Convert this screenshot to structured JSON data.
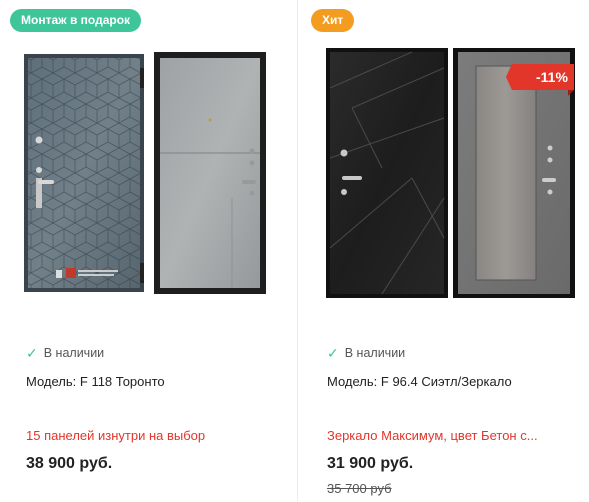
{
  "cards": [
    {
      "badge": "Монтаж в подарок",
      "stock": "В наличии",
      "model": "Модель: F 118 Торонто",
      "promo": "15 панелей изнутри на выбор",
      "price": "38 900 руб."
    },
    {
      "badge": "Хит",
      "discount": "-11%",
      "stock": "В наличии",
      "model": "Модель: F 96.4 Сиэтл/Зеркало",
      "promo": "Зеркало Максимум, цвет Бетон с...",
      "price": "31 900 руб.",
      "old_price": "35 700 руб"
    }
  ],
  "colors": {
    "badge_green": "#3ec59a",
    "badge_orange": "#f39c1f",
    "discount_red": "#e2362a",
    "promo_red": "#e2362a"
  },
  "icons": [
    "check-icon"
  ]
}
